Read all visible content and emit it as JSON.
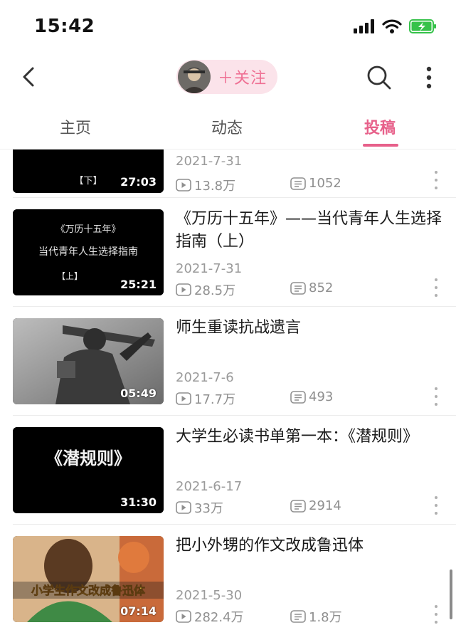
{
  "status_bar": {
    "time": "15:42"
  },
  "nav": {
    "follow_label": "＋关注"
  },
  "tabs": [
    {
      "label": "主页",
      "active": false
    },
    {
      "label": "动态",
      "active": false
    },
    {
      "label": "投稿",
      "active": true
    }
  ],
  "accent_color": "#e7608a",
  "videos": [
    {
      "thumb_text": [
        "【下】"
      ],
      "duration": "27:03",
      "title": "",
      "date": "2021-7-31",
      "views": "13.8万",
      "danmaku": "1052"
    },
    {
      "thumb_text": [
        "《万历十五年》",
        "当代青年人生选择指南",
        "【上】"
      ],
      "duration": "25:21",
      "title": "《万历十五年》——当代青年人生选择指南（上）",
      "date": "2021-7-31",
      "views": "28.5万",
      "danmaku": "852"
    },
    {
      "thumb_text": [],
      "duration": "05:49",
      "title": "师生重读抗战遗言",
      "date": "2021-7-6",
      "views": "17.7万",
      "danmaku": "493"
    },
    {
      "thumb_text": [
        "《潜规则》"
      ],
      "duration": "31:30",
      "title": "大学生必读书单第一本：《潜规则》",
      "date": "2021-6-17",
      "views": "33万",
      "danmaku": "2914"
    },
    {
      "thumb_text": [
        "小学生作文改成鲁迅体"
      ],
      "duration": "07:14",
      "title": "把小外甥的作文改成鲁迅体",
      "date": "2021-5-30",
      "views": "282.4万",
      "danmaku": "1.8万"
    }
  ]
}
